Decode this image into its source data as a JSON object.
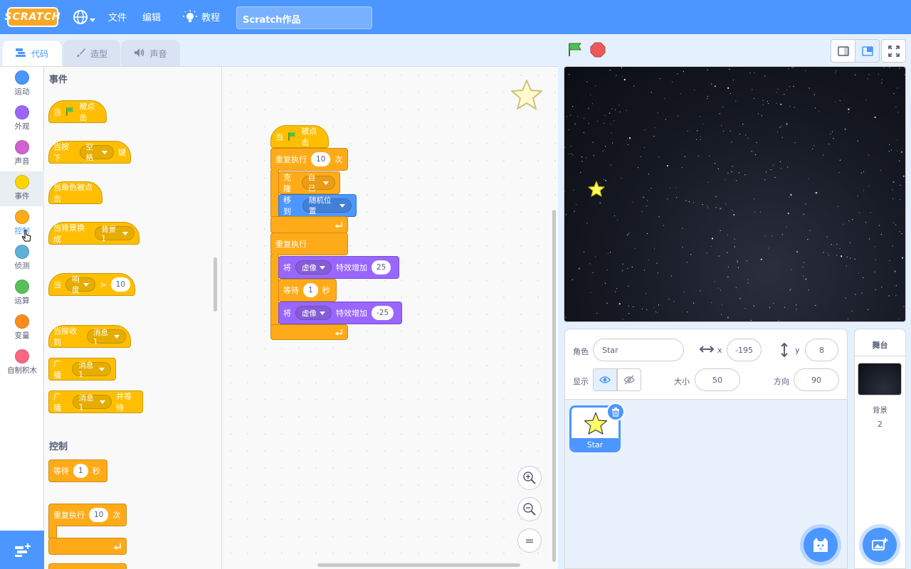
{
  "menubar": {
    "logo": "SCRATCH",
    "file": "文件",
    "edit": "编辑",
    "tutorials": "教程",
    "project_title": "Scratch作品"
  },
  "tabs": {
    "code": "代码",
    "costumes": "造型",
    "sounds": "声音"
  },
  "categories": [
    {
      "label": "运动",
      "color": "#4c97ff"
    },
    {
      "label": "外观",
      "color": "#9966ff"
    },
    {
      "label": "声音",
      "color": "#cf63cf"
    },
    {
      "label": "事件",
      "color": "#ffd500"
    },
    {
      "label": "控制",
      "color": "#ffab19"
    },
    {
      "label": "侦测",
      "color": "#5cb1d6"
    },
    {
      "label": "运算",
      "color": "#59c059"
    },
    {
      "label": "变量",
      "color": "#ff8c1a"
    },
    {
      "label": "自制积木",
      "color": "#ff6680"
    }
  ],
  "palette": {
    "events_title": "事件",
    "when": "当",
    "clicked": "被点击",
    "when_key_pressed": "当按下",
    "key_space": "空格",
    "key": "键",
    "when_sprite_clicked": "当角色被点击",
    "when_backdrop_switches": "当背景换成",
    "backdrop1": "背景1",
    "loudness": "响度",
    "gt": ">",
    "loud_value": "10",
    "when_receive": "当接收到",
    "message1": "消息1",
    "broadcast": "广播",
    "and_wait": "并等待",
    "control_title": "控制",
    "wait": "等待",
    "wait_value": "1",
    "seconds": "秒",
    "repeat": "重复执行",
    "repeat_value": "10",
    "times": "次"
  },
  "script": {
    "when": "当",
    "clicked": "被点击",
    "repeat": "重复执行",
    "repeat_value": "10",
    "times": "次",
    "clone": "克隆",
    "myself": "自己",
    "goto": "移到",
    "random_pos": "随机位置",
    "forever": "重复执行",
    "set_effect": "将",
    "effect_ghost": "虚像",
    "change_by": "特效增加",
    "effect_plus": "25",
    "wait": "等待",
    "wait_value": "1",
    "seconds": "秒",
    "effect_minus": "-25",
    "zoom_reset": "="
  },
  "sprite_info": {
    "sprite_label": "角色",
    "sprite_name": "Star",
    "x_label": "x",
    "x_value": "-195",
    "y_label": "y",
    "y_value": "8",
    "show_label": "显示",
    "size_label": "大小",
    "size_value": "50",
    "direction_label": "方向",
    "direction_value": "90"
  },
  "sprites": [
    {
      "name": "Star",
      "selected": true
    }
  ],
  "stage_pane": {
    "title": "舞台",
    "backdrops_label": "背景",
    "backdrops_count": "2"
  }
}
